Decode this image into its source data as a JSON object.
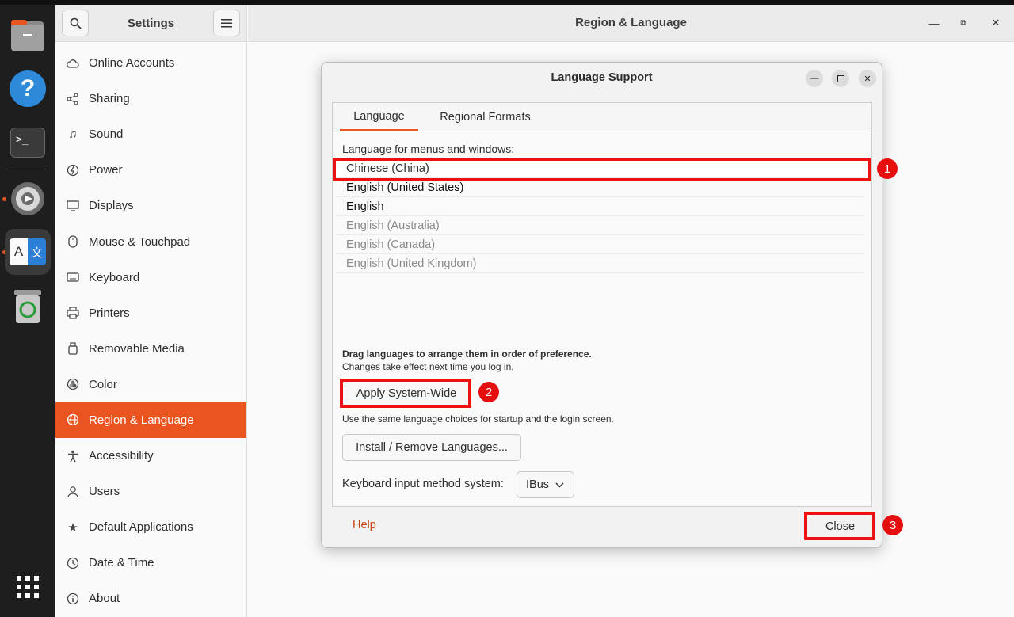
{
  "dock": {
    "items": [
      {
        "name": "files-icon"
      },
      {
        "name": "help-icon",
        "glyph": "?"
      },
      {
        "name": "terminal-icon",
        "glyph": ">_"
      },
      {
        "name": "settings-icon"
      },
      {
        "name": "language-icon",
        "glyph_a": "A",
        "glyph_b": "文"
      },
      {
        "name": "trash-icon"
      },
      {
        "name": "app-grid-icon"
      }
    ]
  },
  "sidebar": {
    "title": "Settings",
    "items": [
      {
        "label": "Online Accounts",
        "icon": "cloud-icon"
      },
      {
        "label": "Sharing",
        "icon": "share-icon"
      },
      {
        "label": "Sound",
        "icon": "music-note-icon"
      },
      {
        "label": "Power",
        "icon": "power-icon"
      },
      {
        "label": "Displays",
        "icon": "display-icon"
      },
      {
        "label": "Mouse & Touchpad",
        "icon": "mouse-icon"
      },
      {
        "label": "Keyboard",
        "icon": "keyboard-icon"
      },
      {
        "label": "Printers",
        "icon": "printer-icon"
      },
      {
        "label": "Removable Media",
        "icon": "usb-drive-icon"
      },
      {
        "label": "Color",
        "icon": "color-icon"
      },
      {
        "label": "Region & Language",
        "icon": "globe-icon",
        "selected": true
      },
      {
        "label": "Accessibility",
        "icon": "accessibility-icon"
      },
      {
        "label": "Users",
        "icon": "users-icon"
      },
      {
        "label": "Default Applications",
        "icon": "star-icon"
      },
      {
        "label": "Date & Time",
        "icon": "clock-icon"
      },
      {
        "label": "About",
        "icon": "info-icon"
      }
    ]
  },
  "main": {
    "title": "Region & Language"
  },
  "dialog": {
    "title": "Language Support",
    "tabs": [
      {
        "label": "Language",
        "active": true
      },
      {
        "label": "Regional Formats",
        "active": false
      }
    ],
    "language_label": "Language for menus and windows:",
    "languages": [
      {
        "label": "Chinese (China)",
        "state": "selected"
      },
      {
        "label": "English (United States)",
        "state": "normal"
      },
      {
        "label": "English",
        "state": "strong"
      },
      {
        "label": "English (Australia)",
        "state": "dim"
      },
      {
        "label": "English (Canada)",
        "state": "dim"
      },
      {
        "label": "English (United Kingdom)",
        "state": "dim"
      }
    ],
    "drag_note": "Drag languages to arrange them in order of preference.",
    "change_note": "Changes take effect next time you log in.",
    "apply_button": "Apply System-Wide",
    "use_note": "Use the same language choices for startup and the login screen.",
    "install_button": "Install / Remove Languages...",
    "keyboard_label": "Keyboard input method system:",
    "keyboard_value": "IBus",
    "help_label": "Help",
    "close_button": "Close"
  },
  "annotations": {
    "badge_1": "1",
    "badge_2": "2",
    "badge_3": "3",
    "color": "#ee1111"
  },
  "colors": {
    "accent": "#e95420",
    "annotation": "#ee1111"
  }
}
